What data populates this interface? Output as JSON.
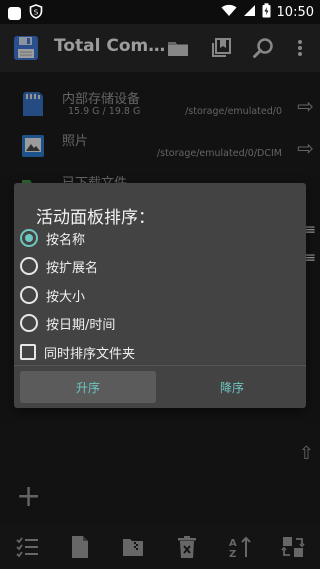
{
  "status_bar": {
    "time": "10:50"
  },
  "app_bar": {
    "title": "Total Com…"
  },
  "list": [
    {
      "title": "内部存储设备",
      "subtitle": "15.9 G / 19.8 G",
      "path": "/storage/emulated/0",
      "icon": "sd-card-icon"
    },
    {
      "title": "照片",
      "subtitle": "",
      "path": "/storage/emulated/0/DCIM",
      "icon": "photo-icon"
    },
    {
      "title": "已下载文件",
      "subtitle": "",
      "path": "",
      "icon": "download-folder-icon"
    }
  ],
  "dialog": {
    "title": "活动面板排序：",
    "options": [
      {
        "label": "按名称",
        "checked": true
      },
      {
        "label": "按扩展名",
        "checked": false
      },
      {
        "label": "按大小",
        "checked": false
      },
      {
        "label": "按日期/时间",
        "checked": false
      }
    ],
    "folder_option": {
      "label": "同时排序文件夹",
      "checked": false
    },
    "ascending_label": "升序",
    "descending_label": "降序"
  },
  "colors": {
    "accent": "#6ec7c0",
    "dialog_bg": "#434343",
    "app_bar_bg": "#2a2a2a"
  }
}
